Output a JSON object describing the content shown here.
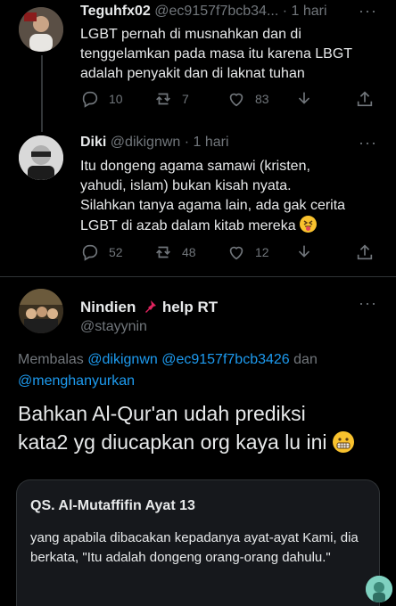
{
  "tweets": [
    {
      "name": "Teguhfx02",
      "handle": "@ec9157f7bcb34...",
      "time": "· 1 hari",
      "text_lines": [
        "LGBT pernah di musnahkan dan di",
        "tenggelamkan pada masa itu karena LBGT",
        "adalah penyakit dan di laknat  tuhan"
      ],
      "replies": "10",
      "retweets": "7",
      "likes": "83"
    },
    {
      "name": "Diki",
      "handle": "@dikignwn",
      "time": "· 1 hari",
      "text_lines": [
        "Itu dongeng agama samawi (kristen,",
        "yahudi, islam) bukan kisah nyata.",
        "Silahkan tanya agama lain, ada gak cerita",
        "LGBT di azab dalam kitab mereka"
      ],
      "replies": "52",
      "retweets": "48",
      "likes": "12"
    }
  ],
  "main": {
    "name": "Nindien",
    "name_suffix": "help RT",
    "handle": "@stayynin",
    "reply_prefix": "Membalas",
    "mentions": [
      "@dikignwn",
      "@ec9157f7bcb3426",
      "@menghanyurkan"
    ],
    "mention_joiner": "dan",
    "text_lines": [
      "Bahkan Al-Qur'an udah prediksi",
      "kata2 yg diucapkan org kaya lu ini"
    ]
  },
  "card": {
    "title": "QS. Al-Mutaffifin Ayat 13",
    "text": "yang apabila dibacakan kepadanya ayat-ayat Kami, dia berkata, \"Itu adalah dongeng orang-orang dahulu.\""
  },
  "colors": {
    "background": "#000000",
    "text": "#e7e9ea",
    "muted": "#71767b",
    "link": "#1d9bf0",
    "divider": "#2f3336"
  }
}
